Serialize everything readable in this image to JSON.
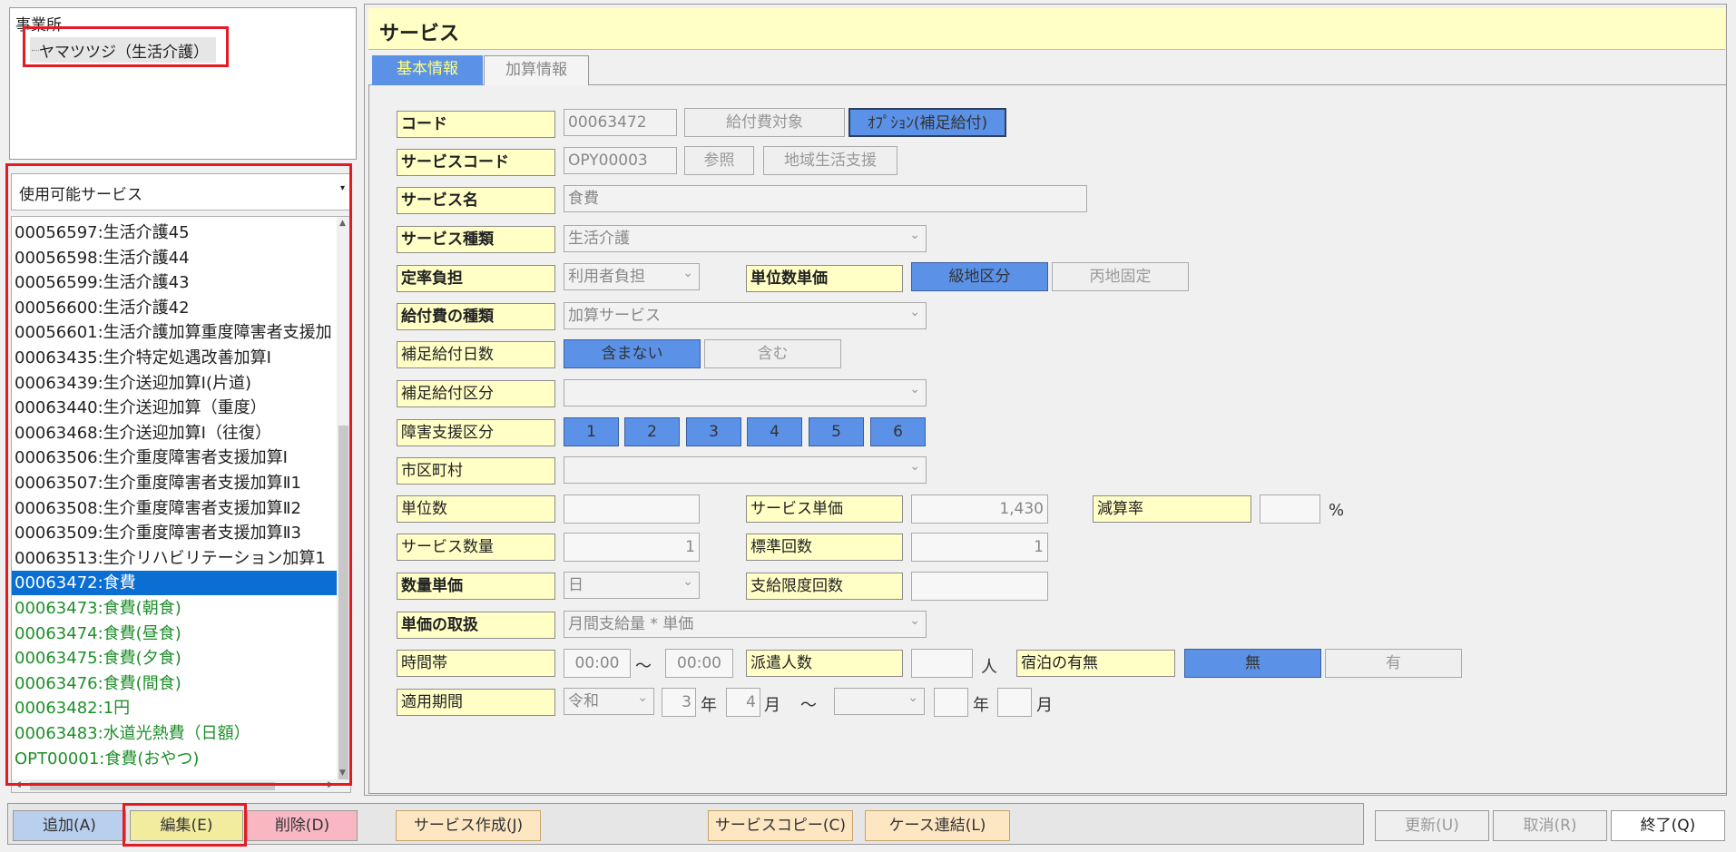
{
  "office": {
    "title": "事業所",
    "node": "ヤマツツジ（生活介護）"
  },
  "service_filter": {
    "value": "使用可能サービス"
  },
  "service_list": [
    {
      "text": "00056597:生活介護45",
      "style": "normal"
    },
    {
      "text": "00056598:生活介護44",
      "style": "normal"
    },
    {
      "text": "00056599:生活介護43",
      "style": "normal"
    },
    {
      "text": "00056600:生活介護42",
      "style": "normal"
    },
    {
      "text": "00056601:生活介護加算重度障害者支援加",
      "style": "normal"
    },
    {
      "text": "00063435:生介特定処遇改善加算Ⅰ",
      "style": "normal"
    },
    {
      "text": "00063439:生介送迎加算Ⅰ(片道)",
      "style": "normal"
    },
    {
      "text": "00063440:生介送迎加算（重度）",
      "style": "normal"
    },
    {
      "text": "00063468:生介送迎加算Ⅰ（往復）",
      "style": "normal"
    },
    {
      "text": "00063506:生介重度障害者支援加算Ⅰ",
      "style": "normal"
    },
    {
      "text": "00063507:生介重度障害者支援加算Ⅱ1",
      "style": "normal"
    },
    {
      "text": "00063508:生介重度障害者支援加算Ⅱ2",
      "style": "normal"
    },
    {
      "text": "00063509:生介重度障害者支援加算Ⅱ3",
      "style": "normal"
    },
    {
      "text": "00063513:生介リハビリテーション加算1",
      "style": "normal"
    },
    {
      "text": "00063472:食費",
      "style": "selected"
    },
    {
      "text": "00063473:食費(朝食)",
      "style": "green"
    },
    {
      "text": "00063474:食費(昼食)",
      "style": "green"
    },
    {
      "text": "00063475:食費(夕食)",
      "style": "green"
    },
    {
      "text": "00063476:食費(間食)",
      "style": "green"
    },
    {
      "text": "00063482:1円",
      "style": "green"
    },
    {
      "text": "00063483:水道光熱費（日額）",
      "style": "green"
    },
    {
      "text": "OPT00001:食費(おやつ)",
      "style": "green"
    }
  ],
  "header": {
    "title": "サービス"
  },
  "tabs": {
    "basic": "基本情報",
    "addition": "加算情報"
  },
  "form": {
    "code_label": "コード",
    "code_value": "00063472",
    "benefit_target_btn": "給付費対象",
    "option_btn": "ｵﾌﾟｼｮﾝ(補足給付)",
    "service_code_label": "サービスコード",
    "service_code_value": "OPY00003",
    "ref_btn": "参照",
    "community_btn": "地域生活支援",
    "service_name_label": "サービス名",
    "service_name_value": "食費",
    "service_type_label": "サービス種類",
    "service_type_value": "生活介護",
    "fixed_burden_label": "定率負担",
    "fixed_burden_value": "利用者負担",
    "unit_price_label": "単位数単価",
    "grade_btn": "級地区分",
    "fixed_area_btn": "丙地固定",
    "benefit_kind_label": "給付費の種類",
    "benefit_kind_value": "加算サービス",
    "supp_days_label": "補足給付日数",
    "not_include_btn": "含まない",
    "include_btn": "含む",
    "supp_category_label": "補足給付区分",
    "support_level_label": "障害支援区分",
    "support_levels": [
      "1",
      "2",
      "3",
      "4",
      "5",
      "6"
    ],
    "city_label": "市区町村",
    "units_label": "単位数",
    "service_unit_price_label": "サービス単価",
    "service_unit_price_value": "1,430",
    "reduction_label": "減算率",
    "percent": "%",
    "service_qty_label": "サービス数量",
    "service_qty_value": "1",
    "standard_count_label": "標準回数",
    "standard_count_value": "1",
    "qty_unit_price_label": "数量単価",
    "qty_unit_price_value": "日",
    "limit_count_label": "支給限度回数",
    "price_handling_label": "単価の取扱",
    "price_handling_value": "月間支給量 * 単価",
    "time_zone_label": "時間帯",
    "time_from": "00:00",
    "tilde": "～",
    "time_to": "00:00",
    "dispatch_label": "派遣人数",
    "person_unit": "人",
    "lodging_label": "宿泊の有無",
    "lodging_no_btn": "無",
    "lodging_yes_btn": "有",
    "period_label": "適用期間",
    "era_value": "令和",
    "year_value": "3",
    "year_unit": "年",
    "month_value": "4",
    "month_unit": "月",
    "tilde2": "～"
  },
  "bottom": {
    "add": "追加(A)",
    "edit": "編集(E)",
    "delete": "削除(D)",
    "create": "サービス作成(J)",
    "copy": "サービスコピー(C)",
    "case_link": "ケース連結(L)",
    "update": "更新(U)",
    "cancel": "取消(R)",
    "exit": "終了(Q)"
  }
}
